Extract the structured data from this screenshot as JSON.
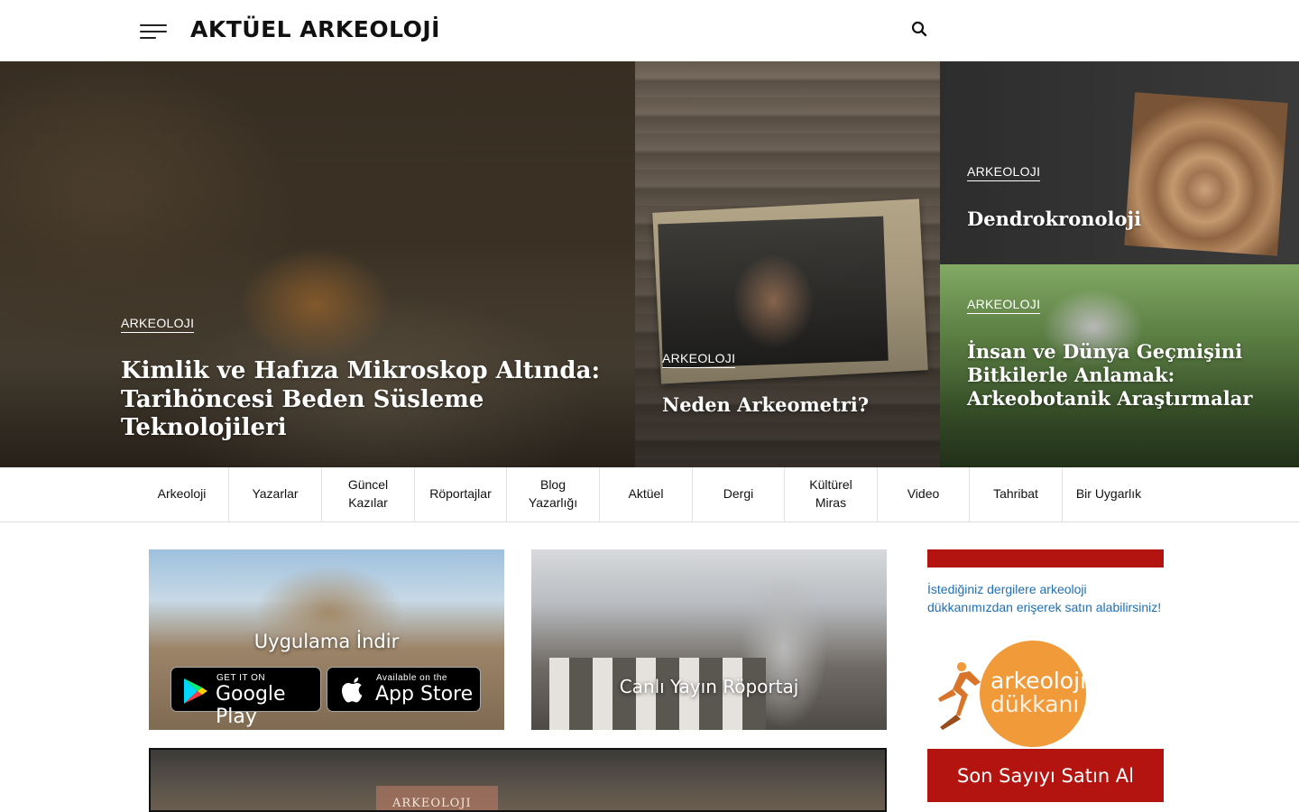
{
  "header": {
    "logo": "AKTÜEL ARKEOLOJİ",
    "menu_icon": "hamburger-menu-icon",
    "search_icon": "search-icon"
  },
  "hero": [
    {
      "category": "ARKEOLOJI",
      "title": "Kimlik ve Hafıza Mikroskop Altında: Tarihöncesi Beden Süsleme Teknolojileri"
    },
    {
      "category": "ARKEOLOJI",
      "title": "Neden Arkeometri?"
    },
    {
      "category": "ARKEOLOJI",
      "title": "Dendrokronoloji"
    },
    {
      "category": "ARKEOLOJI",
      "title": "İnsan ve Dünya Geçmişini Bitkilerle Anlamak: Arkeobotanik Araştırmalar"
    }
  ],
  "nav": [
    "Arkeoloji",
    "Yazarlar",
    "Güncel Kazılar",
    "Röportajlar",
    "Blog Yazarlığı",
    "Aktüel",
    "Dergi",
    "Kültürel Miras",
    "Video",
    "Tahribat",
    "Bir Uygarlık"
  ],
  "promos": {
    "app_title": "Uygulama İndir",
    "google_small": "GET IT ON",
    "google_large": "Google Play",
    "apple_small": "Available on the",
    "apple_large": "App Store",
    "live_title": "Canlı Yayın Röportaj",
    "magazine_text": "ARKEOLOJI"
  },
  "sidebar": {
    "text": "İstediğiniz dergilere arkeoloji dükkanımızdan erişerek satın alabilirsiniz!",
    "shop_line1": "arkeoloji",
    "shop_line2": "dükkanı",
    "buy_button": "Son Sayıyı Satın Al",
    "accent_color": "#b3140f",
    "link_color": "#1f6fb5",
    "shop_color": "#f09a3a"
  }
}
